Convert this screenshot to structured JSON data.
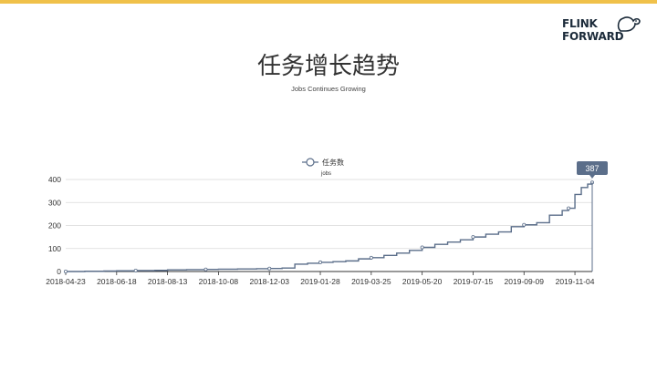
{
  "header": {
    "title": "任务增长趋势",
    "subtitle": "Jobs Continues Growing"
  },
  "logo": {
    "line1": "FLINK",
    "line2": "FORWARD"
  },
  "colors": {
    "accent": "#f0c14a",
    "series": "#5b6e8a",
    "grid": "#d9d9d9",
    "callout": "#5b6e8a"
  },
  "chart_data": {
    "type": "line",
    "title": "",
    "xlabel": "",
    "ylabel": "jobs",
    "legend": {
      "label": "任务数",
      "position": "top-center"
    },
    "ylim": [
      0,
      400
    ],
    "yticks": [
      0,
      100,
      200,
      300,
      400
    ],
    "xticks": [
      "2018-04-23",
      "2018-06-18",
      "2018-08-13",
      "2018-10-08",
      "2018-12-03",
      "2019-01-28",
      "2019-03-25",
      "2019-05-20",
      "2019-07-15",
      "2019-09-09",
      "2019-11-04"
    ],
    "xrange": [
      "2018-04-23",
      "2019-11-23"
    ],
    "highlight": {
      "date": "2019-11-23",
      "value": 387,
      "label": "387"
    },
    "series": [
      {
        "name": "任务数",
        "dates": [
          "2018-04-23",
          "2018-05-14",
          "2018-06-04",
          "2018-06-18",
          "2018-07-09",
          "2018-07-30",
          "2018-08-13",
          "2018-09-03",
          "2018-09-24",
          "2018-10-08",
          "2018-10-29",
          "2018-11-19",
          "2018-12-03",
          "2018-12-17",
          "2018-12-31",
          "2019-01-14",
          "2019-01-28",
          "2019-02-11",
          "2019-02-25",
          "2019-03-11",
          "2019-03-25",
          "2019-04-08",
          "2019-04-22",
          "2019-05-06",
          "2019-05-20",
          "2019-06-03",
          "2019-06-17",
          "2019-07-01",
          "2019-07-15",
          "2019-07-29",
          "2019-08-12",
          "2019-08-26",
          "2019-09-09",
          "2019-09-23",
          "2019-10-07",
          "2019-10-21",
          "2019-10-28",
          "2019-11-04",
          "2019-11-11",
          "2019-11-18",
          "2019-11-23"
        ],
        "values": [
          0,
          1,
          2,
          3,
          4,
          5,
          7,
          8,
          9,
          10,
          11,
          12,
          13,
          15,
          32,
          36,
          40,
          43,
          46,
          55,
          60,
          70,
          80,
          92,
          105,
          118,
          128,
          138,
          150,
          162,
          172,
          195,
          203,
          212,
          245,
          265,
          275,
          335,
          365,
          380,
          387
        ]
      }
    ]
  }
}
